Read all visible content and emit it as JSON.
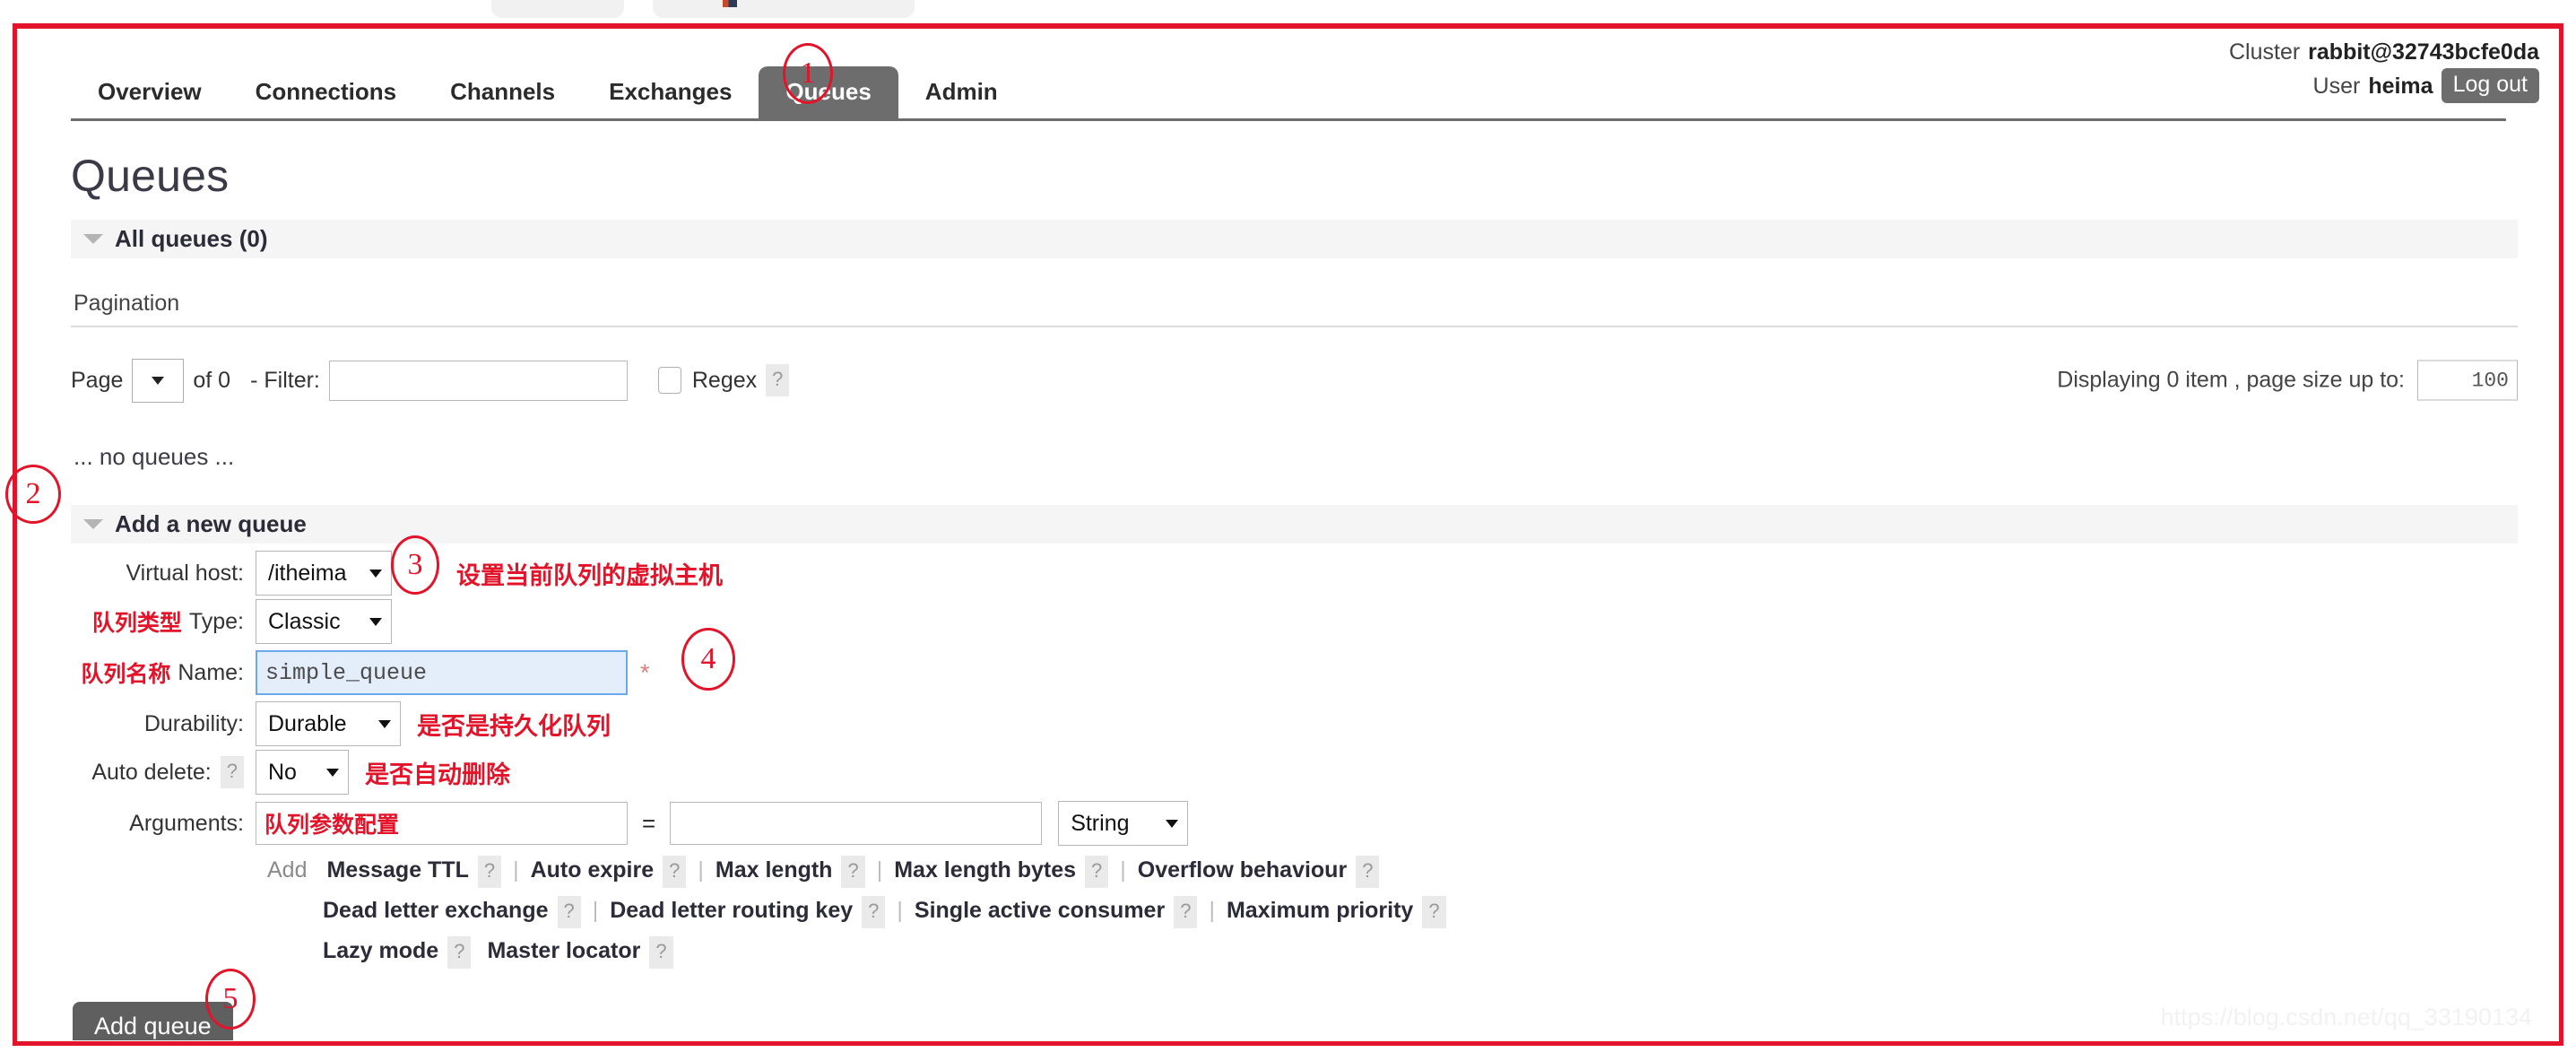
{
  "header": {
    "cluster_label": "Cluster",
    "cluster_name": "rabbit@32743bcfe0da",
    "user_label": "User",
    "user_name": "heima",
    "logout_label": "Log out"
  },
  "nav": {
    "items": [
      {
        "label": "Overview",
        "active": false
      },
      {
        "label": "Connections",
        "active": false
      },
      {
        "label": "Channels",
        "active": false
      },
      {
        "label": "Exchanges",
        "active": false
      },
      {
        "label": "Queues",
        "active": true
      },
      {
        "label": "Admin",
        "active": false
      }
    ]
  },
  "page": {
    "title": "Queues",
    "all_queues_label": "All queues (0)",
    "no_queues_text": "... no queues ...",
    "add_queue_section_label": "Add a new queue"
  },
  "pagination": {
    "title": "Pagination",
    "page_label": "Page",
    "page_value": "",
    "of_text": "of 0",
    "filter_label": "- Filter:",
    "filter_value": "",
    "filter_placeholder": "",
    "regex_label": "Regex",
    "regex_help": "?",
    "regex_checked": false,
    "displaying_text": "Displaying 0 item , page size up to:",
    "page_size_value": "100"
  },
  "form": {
    "virtual_host": {
      "label": "Virtual host:",
      "value": "/itheima",
      "note": "设置当前队列的虚拟主机"
    },
    "type": {
      "label": "Type:",
      "cn_prefix": "队列类型",
      "value": "Classic"
    },
    "name": {
      "label": "Name:",
      "cn_prefix": "队列名称",
      "value": "simple_queue",
      "required_mark": "*"
    },
    "durability": {
      "label": "Durability:",
      "value": "Durable",
      "note": "是否是持久化队列"
    },
    "auto_delete": {
      "label": "Auto delete:",
      "help": "?",
      "value": "No",
      "note": "是否自动删除"
    },
    "arguments": {
      "label": "Arguments:",
      "key_value": "队列参数配置",
      "key_placeholder": "",
      "equals": "=",
      "value_value": "",
      "value_placeholder": "",
      "type_value": "String",
      "add_word": "Add",
      "presets_row1": [
        {
          "label": "Message TTL",
          "help": "?"
        },
        {
          "label": "Auto expire",
          "help": "?"
        },
        {
          "label": "Max length",
          "help": "?"
        },
        {
          "label": "Max length bytes",
          "help": "?"
        },
        {
          "label": "Overflow behaviour",
          "help": "?"
        }
      ],
      "presets_row2": [
        {
          "label": "Dead letter exchange",
          "help": "?"
        },
        {
          "label": "Dead letter routing key",
          "help": "?"
        },
        {
          "label": "Single active consumer",
          "help": "?"
        },
        {
          "label": "Maximum priority",
          "help": "?"
        }
      ],
      "presets_row3": [
        {
          "label": "Lazy mode",
          "help": "?"
        },
        {
          "label": "Master locator",
          "help": "?"
        }
      ],
      "separator": "|"
    },
    "submit_label": "Add queue"
  },
  "annotations": {
    "steps": [
      "1",
      "2",
      "3",
      "4",
      "5"
    ],
    "accent_color": "#e3142a"
  },
  "watermark": "https://blog.csdn.net/qq_33190134"
}
